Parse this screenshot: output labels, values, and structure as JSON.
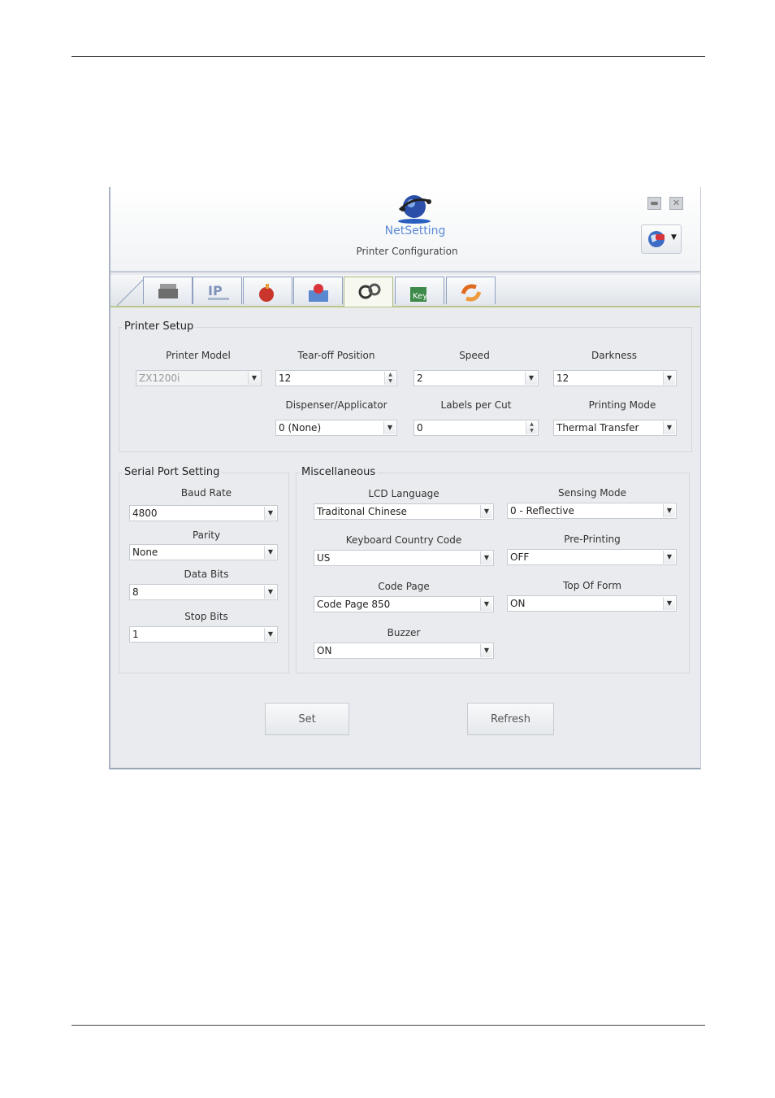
{
  "app": {
    "logo_text": "NetSetting",
    "subtitle": "Printer Configuration"
  },
  "tabs": [
    {
      "name": "printer",
      "label": ""
    },
    {
      "name": "network",
      "label": "IP"
    },
    {
      "name": "alert",
      "label": ""
    },
    {
      "name": "monitor",
      "label": ""
    },
    {
      "name": "setup",
      "label": ""
    },
    {
      "name": "key",
      "label": "Key"
    },
    {
      "name": "sync",
      "label": ""
    }
  ],
  "printer_setup": {
    "title": "Printer Setup",
    "printer_model": {
      "label": "Printer Model",
      "value": "ZX1200i"
    },
    "tear_off": {
      "label": "Tear-off  Position",
      "value": "12"
    },
    "speed": {
      "label": "Speed",
      "value": "2"
    },
    "darkness": {
      "label": "Darkness",
      "value": "12"
    },
    "dispenser": {
      "label": "Dispenser/Applicator",
      "value": "0 (None)"
    },
    "labels_per_cut": {
      "label": "Labels per Cut",
      "value": "0"
    },
    "printing_mode": {
      "label": "Printing Mode",
      "value": "Thermal Transfer"
    }
  },
  "serial": {
    "title": "Serial Port Setting",
    "baud": {
      "label": "Baud Rate",
      "value": "4800"
    },
    "parity": {
      "label": "Parity",
      "value": "None"
    },
    "data_bits": {
      "label": "Data Bits",
      "value": "8"
    },
    "stop_bits": {
      "label": "Stop Bits",
      "value": "1"
    }
  },
  "misc": {
    "title": "Miscellaneous",
    "lcd": {
      "label": "LCD Language",
      "value": "Traditonal Chinese"
    },
    "sensing": {
      "label": "Sensing Mode",
      "value": "0 - Reflective"
    },
    "keyboard": {
      "label": "Keyboard Country Code",
      "value": "US"
    },
    "preprint": {
      "label": "Pre-Printing",
      "value": "OFF"
    },
    "codepage": {
      "label": "Code Page",
      "value": "Code Page 850"
    },
    "topofform": {
      "label": "Top Of Form",
      "value": "ON"
    },
    "buzzer": {
      "label": "Buzzer",
      "value": "ON"
    }
  },
  "buttons": {
    "set": "Set",
    "refresh": "Refresh"
  },
  "colors": {
    "accent": "#2b4fa8",
    "tab_border": "#8fa1bf",
    "active_tab_line": "#b8c889"
  }
}
